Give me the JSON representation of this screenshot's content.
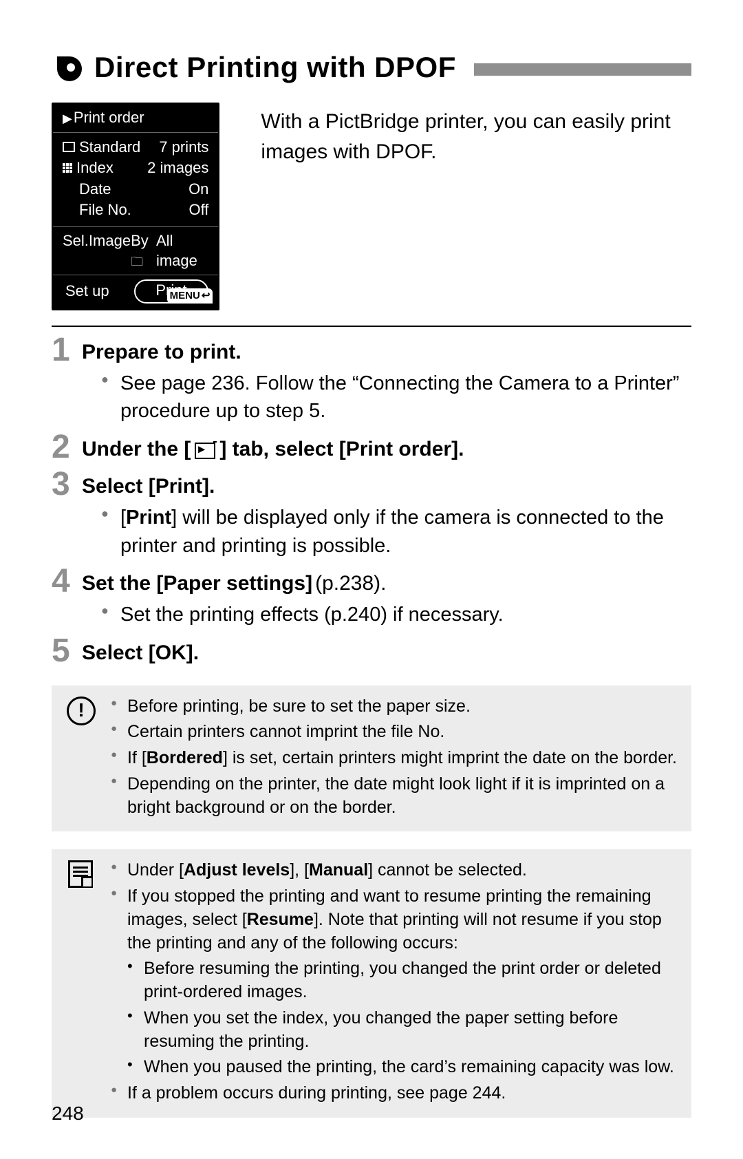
{
  "title": "Direct Printing with DPOF",
  "lcd": {
    "title": "Print order",
    "rows": [
      {
        "label": "Standard",
        "value": "7 prints",
        "icon": "square"
      },
      {
        "label": "Index",
        "value": "2 images",
        "icon": "grid"
      },
      {
        "label": "Date",
        "value": "On",
        "icon": ""
      },
      {
        "label": "File No.",
        "value": "Off",
        "icon": ""
      }
    ],
    "tabs": {
      "left": "Sel.Image",
      "mid": "By",
      "right": "All image"
    },
    "bottom": {
      "setup": "Set up",
      "print": "Print",
      "menu": "MENU"
    }
  },
  "intro": "With a PictBridge printer, you can easily print images with DPOF.",
  "steps": {
    "s1": {
      "num": "1",
      "head": "Prepare to print.",
      "bullet1": "See page 236. Follow the “Connecting the Camera to a Printer” procedure up to step 5."
    },
    "s2": {
      "num": "2",
      "head_before": "Under the [",
      "head_after": "] tab, select [Print order]."
    },
    "s3": {
      "num": "3",
      "head": "Select [Print].",
      "bullet1_pre": "[",
      "bullet1_bold": "Print",
      "bullet1_post": "] will be displayed only if the camera is connected to the printer and printing is possible."
    },
    "s4": {
      "num": "4",
      "head_bold": "Set the [Paper settings]",
      "head_thin": " (p.238).",
      "bullet1": "Set the printing effects (p.240) if necessary."
    },
    "s5": {
      "num": "5",
      "head": "Select [OK]."
    }
  },
  "caution": {
    "b1": "Before printing, be sure to set the paper size.",
    "b2": "Certain printers cannot imprint the file No.",
    "b3_pre": "If [",
    "b3_bold": "Bordered",
    "b3_post": "] is set, certain printers might imprint the date on the border.",
    "b4": "Depending on the printer, the date might look light if it is imprinted on a bright background or on the border."
  },
  "note": {
    "b1_pre": "Under [",
    "b1_bold1": "Adjust levels",
    "b1_mid": "], [",
    "b1_bold2": "Manual",
    "b1_post": "] cannot be selected.",
    "b2_pre": "If you stopped the printing and want to resume printing the remaining images, select [",
    "b2_bold": "Resume",
    "b2_post": "]. Note that printing will not resume if you stop the printing and any of the following occurs:",
    "b2s1": "Before resuming the printing, you changed the print order or deleted print-ordered images.",
    "b2s2": "When you set the index, you changed the paper setting before resuming the printing.",
    "b2s3": "When you paused the printing, the card’s remaining capacity was low.",
    "b3": "If a problem occurs during printing, see page 244."
  },
  "page_number": "248"
}
